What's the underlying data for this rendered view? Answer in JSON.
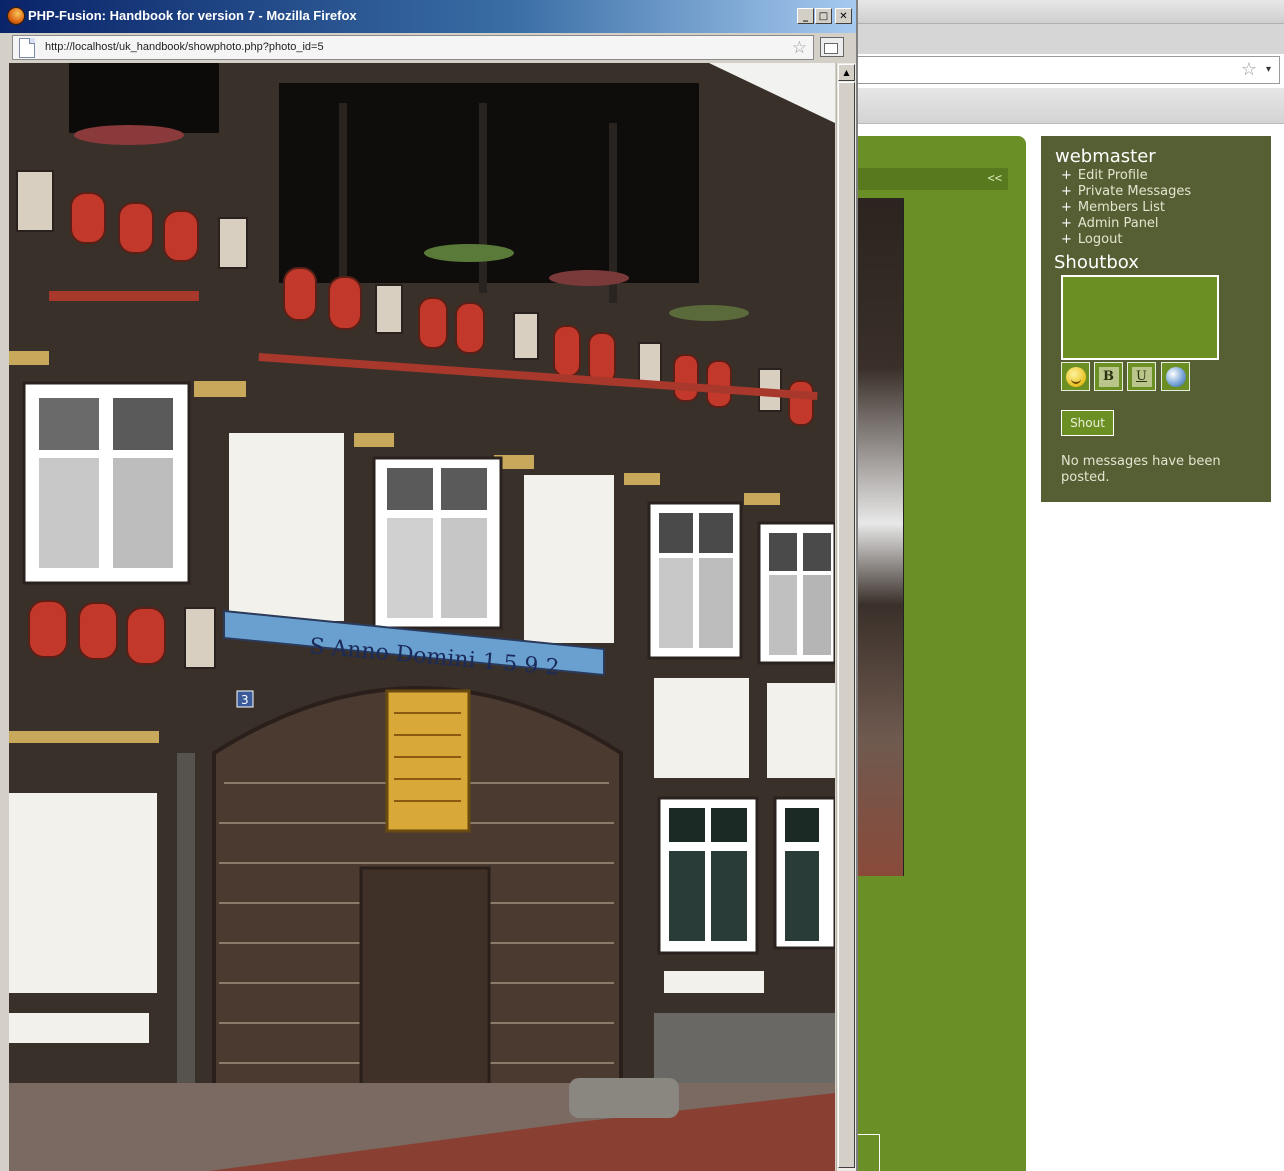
{
  "popup": {
    "title": "PHP-Fusion: Handbook for version 7 - Mozilla Firefox",
    "url": "http://localhost/uk_handbook/showphoto.php?photo_id=5",
    "controls": {
      "minimize": "_",
      "maximize": "□",
      "close": "✕"
    },
    "scroll_up": "▲"
  },
  "photo_sign": {
    "banner_text": "S Anno Domini 1 5 9 2",
    "house_number": "3"
  },
  "background": {
    "collapse_label": "<<",
    "bookmark_star": "☆",
    "dropdown_arrow": "▾",
    "user_panel": {
      "username": "webmaster",
      "links": [
        {
          "bullet": "+",
          "label": "Edit Profile"
        },
        {
          "bullet": "+",
          "label": "Private Messages"
        },
        {
          "bullet": "+",
          "label": "Members List"
        },
        {
          "bullet": "+",
          "label": "Admin Panel"
        },
        {
          "bullet": "+",
          "label": "Logout"
        }
      ]
    },
    "shoutbox": {
      "title": "Shoutbox",
      "format_buttons": {
        "bold": "B",
        "underline": "U"
      },
      "shout_label": "Shout",
      "empty_message": "No messages have been posted."
    }
  },
  "colors": {
    "theme_green": "#6a8f27",
    "panel_olive": "#565f33",
    "titlebar_blue": "#0a246a"
  },
  "icons": [
    "firefox-icon",
    "page-icon",
    "bookmark-star-icon",
    "popout-icon",
    "smiley-icon",
    "globe-link-icon"
  ]
}
